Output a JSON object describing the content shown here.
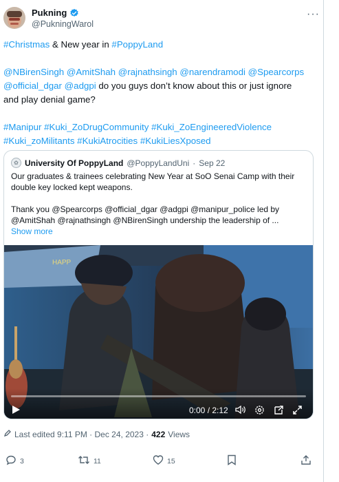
{
  "author": {
    "name": "Pukning",
    "handle": "@PukningWarol"
  },
  "tweet": {
    "line1": [
      {
        "text": "#Christmas",
        "tag": true
      },
      {
        "text": " & New year in ",
        "tag": false
      },
      {
        "text": "#PoppyLand",
        "tag": true
      }
    ],
    "line2": [
      {
        "text": "@NBirenSingh",
        "tag": true
      },
      {
        "text": " ",
        "tag": false
      },
      {
        "text": "@AmitShah",
        "tag": true
      },
      {
        "text": " ",
        "tag": false
      },
      {
        "text": "@rajnathsingh",
        "tag": true
      },
      {
        "text": " ",
        "tag": false
      },
      {
        "text": "@narendramodi",
        "tag": true
      },
      {
        "text": " ",
        "tag": false
      },
      {
        "text": "@Spearcorps",
        "tag": true
      }
    ],
    "line3": [
      {
        "text": "@official_dgar",
        "tag": true
      },
      {
        "text": " ",
        "tag": false
      },
      {
        "text": "@adgpi",
        "tag": true
      },
      {
        "text": " do you guys don’t know about this or just ignore",
        "tag": false
      }
    ],
    "line4": "and play denial game?",
    "line5": [
      {
        "text": "#Manipur",
        "tag": true
      },
      {
        "text": " ",
        "tag": false
      },
      {
        "text": "#Kuki_ZoDrugCommunity",
        "tag": true
      },
      {
        "text": " ",
        "tag": false
      },
      {
        "text": "#Kuki_ZoEngineeredViolence",
        "tag": true
      }
    ],
    "line6": [
      {
        "text": "#Kuki_zoMilitants",
        "tag": true
      },
      {
        "text": " ",
        "tag": false
      },
      {
        "text": "#KukiAtrocities",
        "tag": true
      },
      {
        "text": " ",
        "tag": false
      },
      {
        "text": "#KukiLiesXposed",
        "tag": true
      }
    ]
  },
  "quote": {
    "name": "University Of PoppyLand",
    "handle": "@PoppyLandUni",
    "separator": "·",
    "date": "Sep 22",
    "para1_line1": "Our graduates & trainees celebrating New Year at SoO Senai Camp with their",
    "para1_line2": "double key locked kept weapons.",
    "para2_line1": "Thank you @Spearcorps @official_dgar @adgpi @manipur_police  led by",
    "para2_line2": "@AmitShah @rajnathsingh @NBirenSingh undership the leadership of ...",
    "show_more": "Show more",
    "video": {
      "banner_text": "HAPP",
      "time": "0:00 / 2:12",
      "progress": 0
    }
  },
  "meta": {
    "edited_label": "Last edited 9:11 PM · Dec 24, 2023 ·",
    "views_count": "422",
    "views_label": "Views"
  },
  "actions": {
    "replies": "3",
    "reposts": "11",
    "likes": "15"
  },
  "colors": {
    "accent": "#1d9bf0",
    "secondary_text": "#536471"
  }
}
